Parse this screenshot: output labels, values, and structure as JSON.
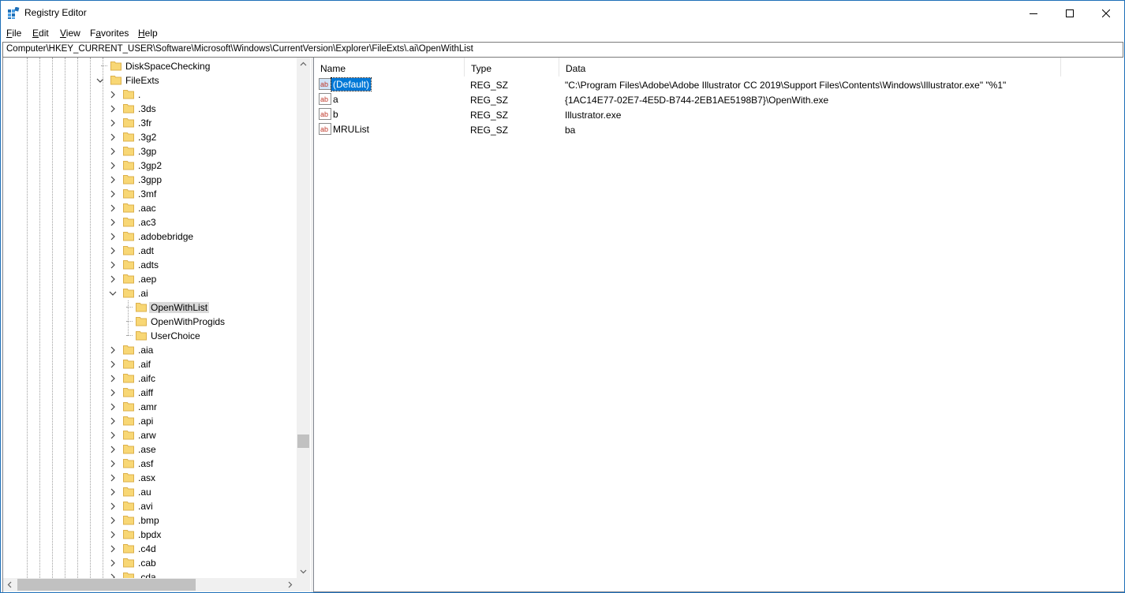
{
  "window": {
    "title": "Registry Editor",
    "controls": {
      "minimize": "minimize",
      "maximize": "maximize",
      "close": "close"
    }
  },
  "menu": [
    {
      "accel": "F",
      "rest": "ile"
    },
    {
      "accel": "E",
      "rest": "dit"
    },
    {
      "accel": "V",
      "rest": "iew"
    },
    {
      "pre": "F",
      "accel": "a",
      "rest": "vorites"
    },
    {
      "accel": "H",
      "rest": "elp"
    }
  ],
  "address": "Computer\\HKEY_CURRENT_USER\\Software\\Microsoft\\Windows\\CurrentVersion\\Explorer\\FileExts\\.ai\\OpenWithList",
  "tree": {
    "top_items": [
      {
        "label": "DiskSpaceChecking",
        "expander": "none"
      },
      {
        "label": "FileExts",
        "expander": "expanded"
      }
    ],
    "ext_before": [
      ".",
      ".3ds",
      ".3fr",
      ".3g2",
      ".3gp",
      ".3gp2",
      ".3gpp",
      ".3mf",
      ".aac",
      ".ac3",
      ".adobebridge",
      ".adt",
      ".adts",
      ".aep"
    ],
    "expanded_ext": ".ai",
    "children": [
      {
        "label": "OpenWithList",
        "selected": true
      },
      {
        "label": "OpenWithProgids",
        "selected": false
      },
      {
        "label": "UserChoice",
        "selected": false
      }
    ],
    "ext_after": [
      ".aia",
      ".aif",
      ".aifc",
      ".aiff",
      ".amr",
      ".api",
      ".arw",
      ".ase",
      ".asf",
      ".asx",
      ".au",
      ".avi",
      ".bmp",
      ".bpdx",
      ".c4d",
      ".cab",
      ".cda"
    ]
  },
  "values_pane": {
    "columns": [
      "Name",
      "Type",
      "Data"
    ],
    "rows": [
      {
        "name": "(Default)",
        "type": "REG_SZ",
        "data": "\"C:\\Program Files\\Adobe\\Adobe Illustrator CC 2019\\Support Files\\Contents\\Windows\\Illustrator.exe\" \"%1\"",
        "selected": true,
        "icon": "string-value-icon"
      },
      {
        "name": "a",
        "type": "REG_SZ",
        "data": "{1AC14E77-02E7-4E5D-B744-2EB1AE5198B7}\\OpenWith.exe",
        "selected": false,
        "icon": "string-value-icon"
      },
      {
        "name": "b",
        "type": "REG_SZ",
        "data": "Illustrator.exe",
        "selected": false,
        "icon": "string-value-icon"
      },
      {
        "name": "MRUList",
        "type": "REG_SZ",
        "data": "ba",
        "selected": false,
        "icon": "string-value-icon"
      }
    ]
  },
  "colors": {
    "folder": "#f8d775",
    "folder_edge": "#dcb04c",
    "selection": "#0078d7",
    "tree_selection": "#d9d9d9",
    "window_border": "#1e6fb8"
  }
}
